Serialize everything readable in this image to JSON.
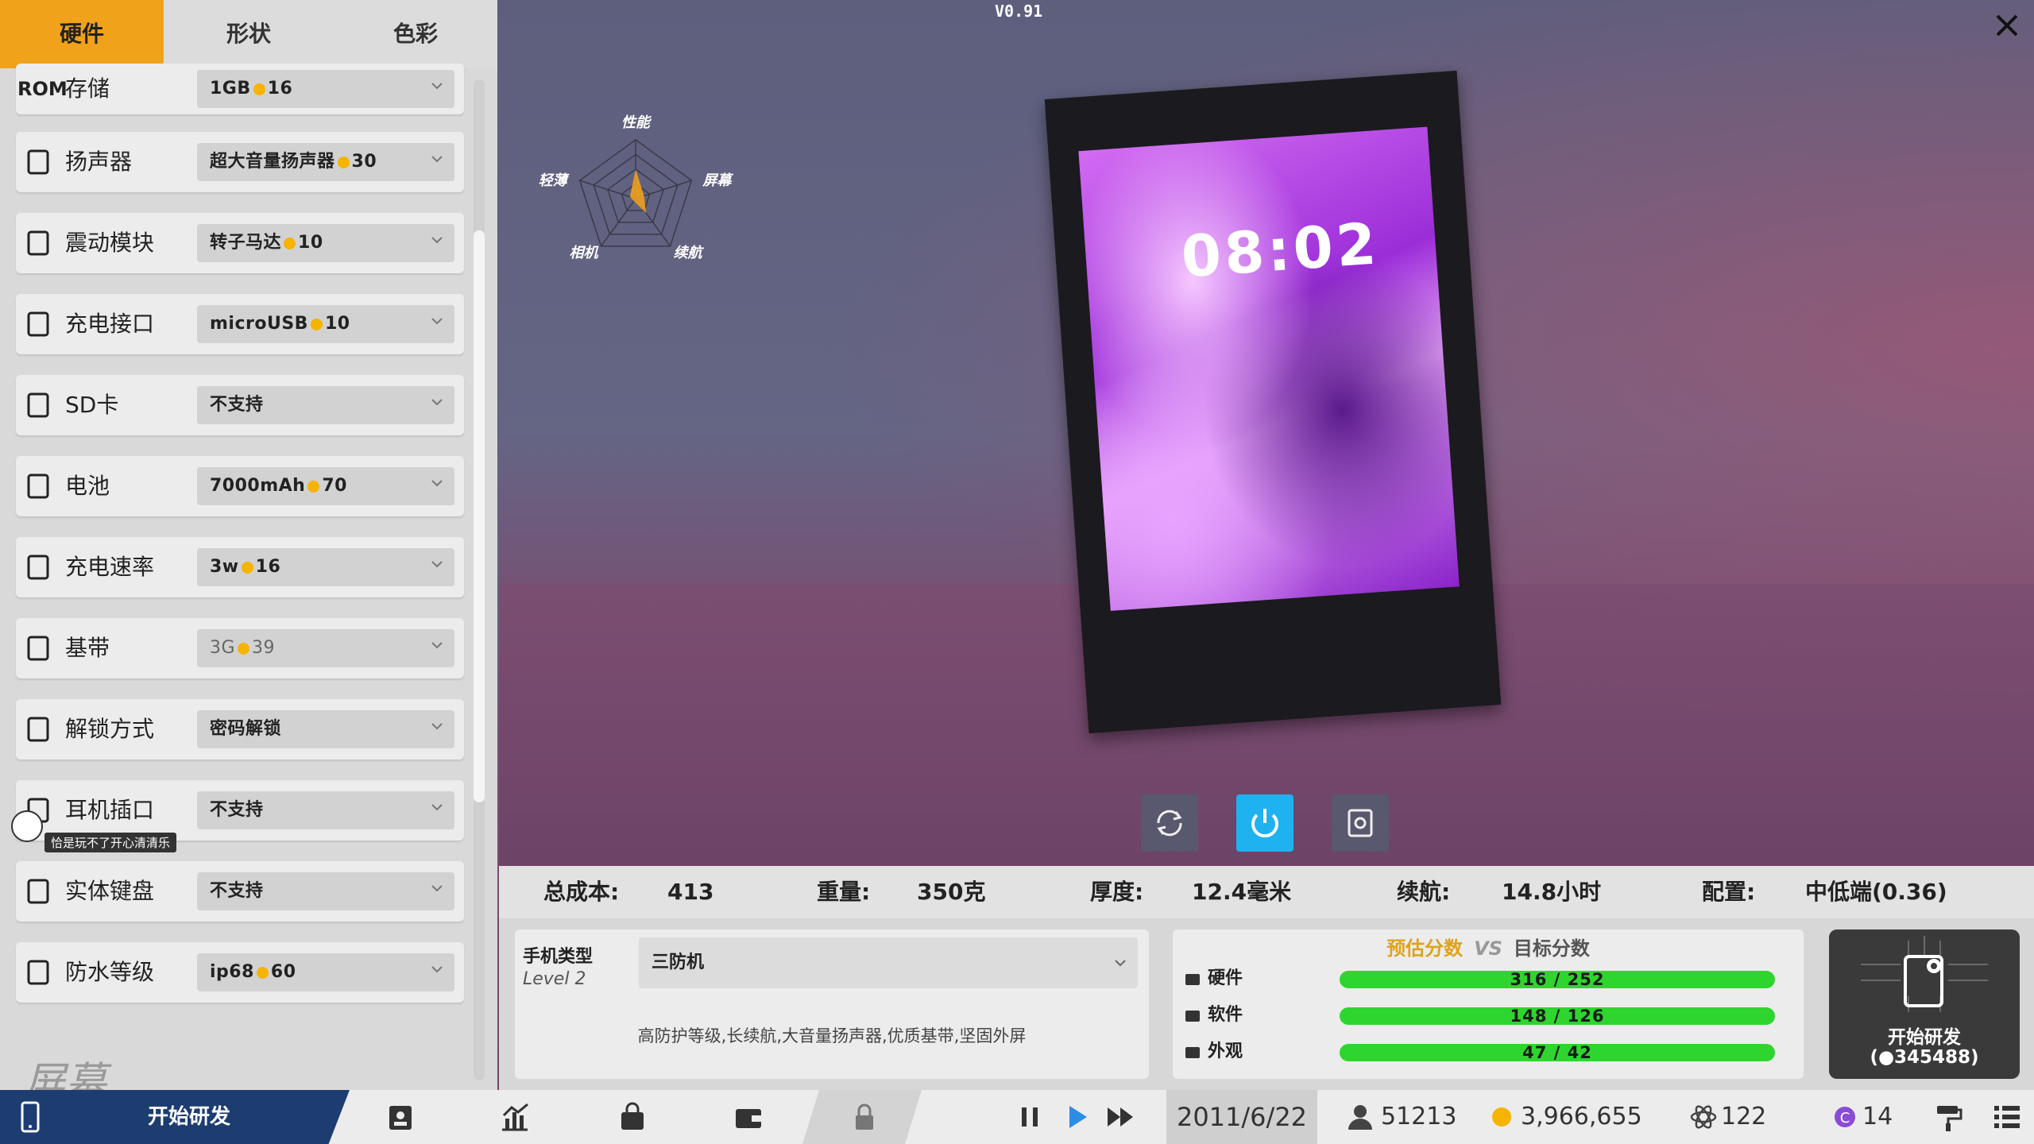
{
  "version": "V0.91",
  "tabs": [
    {
      "label": "硬件"
    },
    {
      "label": "形状"
    },
    {
      "label": "色彩"
    }
  ],
  "hardware_rows": [
    {
      "label": "存储",
      "prefix": "ROM",
      "value": "1GB",
      "cost": "16",
      "icon": "storage-icon"
    },
    {
      "label": "扬声器",
      "value": "超大音量扬声器",
      "cost": "30",
      "icon": "speaker-icon"
    },
    {
      "label": "震动模块",
      "value": "转子马达",
      "cost": "10",
      "icon": "vibration-icon"
    },
    {
      "label": "充电接口",
      "value": "microUSB",
      "cost": "10",
      "icon": "charging-port-icon"
    },
    {
      "label": "SD卡",
      "value": "不支持",
      "cost": "",
      "icon": "sd-card-icon"
    },
    {
      "label": "电池",
      "value": "7000mAh",
      "cost": "70",
      "icon": "battery-icon"
    },
    {
      "label": "充电速率",
      "value": "3w",
      "cost": "16",
      "icon": "charging-speed-icon"
    },
    {
      "label": "基带",
      "value": "3G",
      "cost": "39",
      "icon": "baseband-icon"
    },
    {
      "label": "解锁方式",
      "value": "密码解锁",
      "cost": "",
      "icon": "lock-icon"
    },
    {
      "label": "耳机插口",
      "value": "不支持",
      "cost": "",
      "icon": "headphone-jack-icon"
    },
    {
      "label": "实体键盘",
      "value": "不支持",
      "cost": "",
      "icon": "keyboard-icon"
    },
    {
      "label": "防水等级",
      "value": "ip68",
      "cost": "60",
      "icon": "umbrella-icon"
    }
  ],
  "next_section": "屏幕",
  "tooltip_text": "恰是玩不了开心清清乐",
  "radar": {
    "labels": [
      "性能",
      "屏幕",
      "续航",
      "相机",
      "轻薄"
    ],
    "values": [
      0.5,
      0.15,
      0.3,
      0.05,
      0.1
    ],
    "color": "#f0a21a"
  },
  "phone_clock": "08:02",
  "stats": {
    "cost_label": "总成本:",
    "cost": "413",
    "weight_label": "重量:",
    "weight": "350克",
    "thickness_label": "厚度:",
    "thickness": "12.4毫米",
    "battery_label": "续航:",
    "battery": "14.8小时",
    "config_label": "配置:",
    "config": "中低端(0.36)"
  },
  "phone_type": {
    "label": "手机类型",
    "level": "Level 2",
    "value": "三防机",
    "description": "高防护等级,长续航,大音量扬声器,优质基带,坚固外屏"
  },
  "scores": {
    "estimate_label": "预估分数",
    "vs": "VS",
    "target_label": "目标分数",
    "rows": [
      {
        "label": "硬件",
        "text": "316 / 252",
        "icon": "chip-icon"
      },
      {
        "label": "软件",
        "text": "148 / 126",
        "icon": "window-icon"
      },
      {
        "label": "外观",
        "text": "47 / 42",
        "icon": "palette-icon"
      }
    ]
  },
  "dev_button": {
    "label": "开始研发",
    "cost": "(●345488)"
  },
  "taskbar": {
    "start_label": "开始研发",
    "date": "2011/6/22",
    "fans": "51213",
    "money": "3,966,655",
    "tech": "122",
    "points": "14"
  },
  "colors": {
    "accent": "#f0a21a",
    "taskbar_start": "#1d3d70",
    "bar_green": "#2ed52e",
    "power_button": "#1eb2f0"
  }
}
